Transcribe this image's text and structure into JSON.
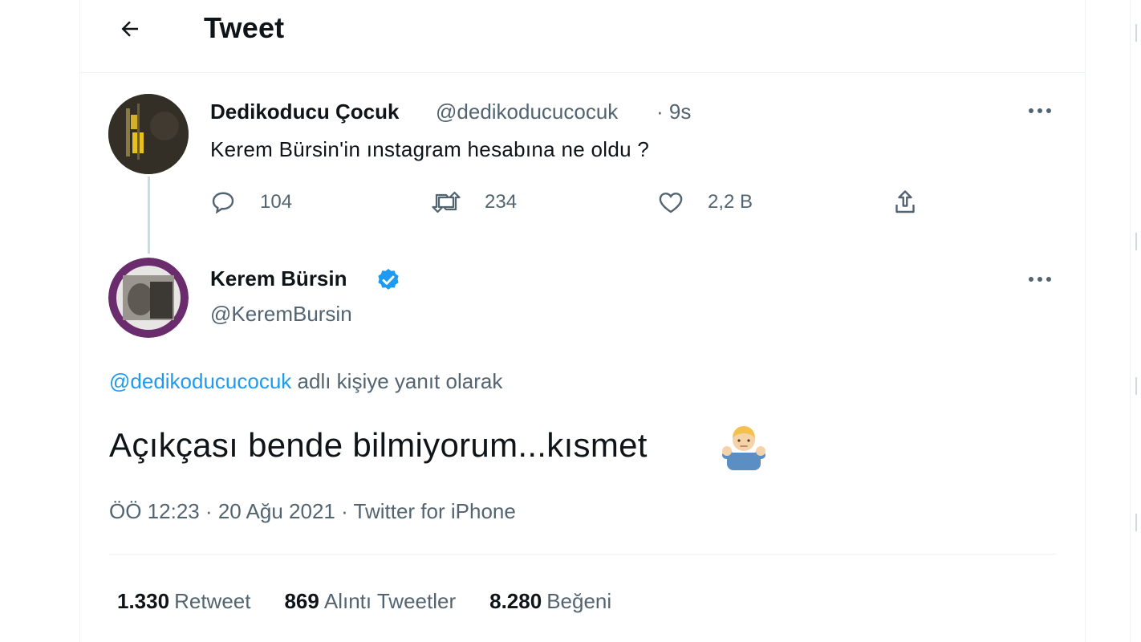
{
  "header": {
    "title": "Tweet",
    "back_icon": "arrow-left-icon"
  },
  "original_tweet": {
    "display_name": "Dedikoducu Çocuk",
    "handle": "@dedikoducucocuk",
    "time": "· 9s",
    "text": "Kerem Bürsin'in ınstagram hesabına ne oldu ?",
    "actions": {
      "reply_count": "104",
      "retweet_count": "234",
      "like_count": "2,2 B"
    }
  },
  "reply_tweet": {
    "display_name": "Kerem Bürsin",
    "handle": "@KeremBursin",
    "verified": true,
    "reply_to_mention": "@dedikoducucocuk",
    "reply_to_suffix": " adlı kişiye yanıt olarak",
    "text": "Açıkçası bende bilmiyorum...kısmet",
    "emoji": "person-shrugging-emoji",
    "timestamp": "ÖÖ 12:23 · 20 Ağu 2021 · ",
    "source": "Twitter for iPhone"
  },
  "stats": [
    {
      "count": "1.330",
      "label": "Retweet"
    },
    {
      "count": "869",
      "label": "Alıntı Tweetler"
    },
    {
      "count": "8.280",
      "label": "Beğeni"
    }
  ],
  "colors": {
    "accent": "#1d9bf0",
    "text_primary": "#0f1419",
    "text_secondary": "#536471",
    "border": "#eff3f4"
  }
}
